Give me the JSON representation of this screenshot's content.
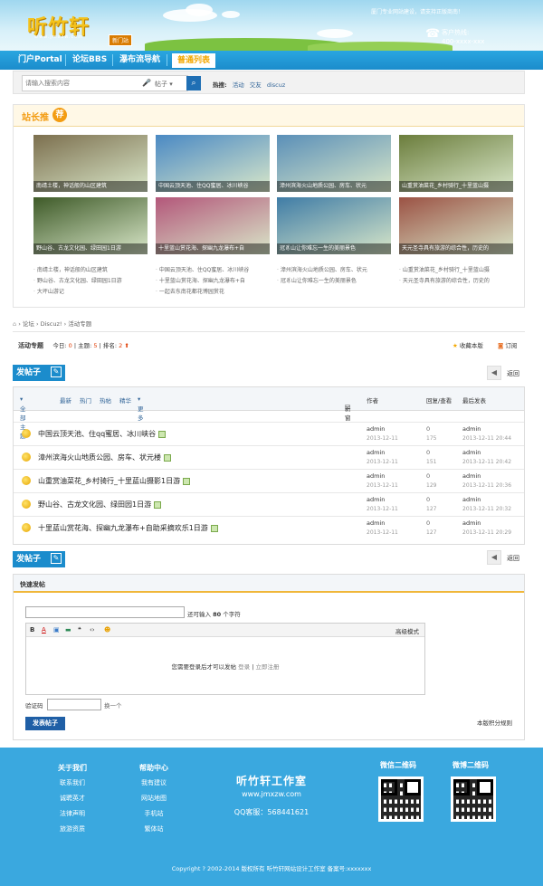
{
  "header": {
    "logo": "听竹轩",
    "logo_sub": "www.jmxzw.com",
    "logo_badge": "新门站",
    "slogan": "厦门专业网站建设，请支持正版商南！",
    "hotline_label": "客户热线:",
    "hotline_number": "400-xxxx-xxx"
  },
  "nav": {
    "items": [
      "门户Portal",
      "论坛BBS",
      "瀑布流导航",
      "普通列表"
    ]
  },
  "search": {
    "placeholder": "请输入搜索内容",
    "scope": "帖子",
    "hot_label": "热搜:",
    "hot_words": [
      "活动",
      "交友",
      "discuz"
    ]
  },
  "recommend": {
    "title": "站长推",
    "badge": "荐",
    "photos": [
      {
        "caption": "南靖土楼，神话般的山区建筑",
        "bg": "#7c6f4e"
      },
      {
        "caption": "中国云顶天池、住QQ蜜居、冰川峡谷",
        "bg": "#4a89c4"
      },
      {
        "caption": "漳州滨海火山地质公园、房车、状元",
        "bg": "#5a8fb8"
      },
      {
        "caption": "山重赏油菜花_乡村骑行_十里蓝山摄",
        "bg": "#6b7d3c"
      },
      {
        "caption": "野山谷、古龙文化园、绿田园1日游",
        "bg": "#3e5a28"
      },
      {
        "caption": "十里蓝山赏花海、探幽九龙瀑布+自",
        "bg": "#b3577a"
      },
      {
        "caption": "冠豸山让你难忘一生的美丽景色",
        "bg": "#3f7ca6"
      },
      {
        "caption": "天元圣寺具有旅游的综合性，历史的",
        "bg": "#9b5244"
      }
    ],
    "links": [
      [
        "南靖土楼，神话般的山区建筑",
        "野山谷、古龙文化园、绿田园1日游",
        "大坪山游记"
      ],
      [
        "中国云顶天池、住QQ蜜居、冰川峡谷",
        "十里蓝山赏花海、探幽九龙瀑布+自",
        "一起去东南花都花博园赏花"
      ],
      [
        "漳州滨海火山地质公园、房车、状元",
        "冠豸山让你难忘一生的美丽景色"
      ],
      [
        "山重赏油菜花_乡村骑行_十里蓝山摄",
        "天元圣寺具有旅游的综合性，历史的"
      ]
    ]
  },
  "breadcrumb": [
    "论坛",
    "Discuz!",
    "活动专题"
  ],
  "forum": {
    "name": "活动专题",
    "today_label": "今日:",
    "today": "0",
    "topics_label": "主题:",
    "topics": "5",
    "rank_label": "排名:",
    "rank": "2",
    "favorite": "收藏本版",
    "subscribe": "订阅"
  },
  "actions": {
    "post": "发帖子",
    "back": "返回"
  },
  "thread_head": {
    "filters": [
      "全部主题",
      "最新",
      "热门",
      "热帖",
      "精华",
      "更多"
    ],
    "new_window": "新窗",
    "author": "作者",
    "reply_view": "回复/查看",
    "last_post": "最后发表"
  },
  "threads": [
    {
      "title": "中国云顶天池、住qq蜜居、冰川峡谷",
      "author": "admin",
      "date": "2013-12-11",
      "replies": "0",
      "views": "175",
      "last_author": "admin",
      "last_date": "2013-12-11 20:44"
    },
    {
      "title": "漳州滨海火山地质公园、房车、状元楼",
      "author": "admin",
      "date": "2013-12-11",
      "replies": "0",
      "views": "151",
      "last_author": "admin",
      "last_date": "2013-12-11 20:42"
    },
    {
      "title": "山重赏油菜花_乡村骑行_十里蓝山摄影1日游",
      "author": "admin",
      "date": "2013-12-11",
      "replies": "0",
      "views": "129",
      "last_author": "admin",
      "last_date": "2013-12-11 20:36"
    },
    {
      "title": "野山谷、古龙文化园、绿田园1日游",
      "author": "admin",
      "date": "2013-12-11",
      "replies": "0",
      "views": "127",
      "last_author": "admin",
      "last_date": "2013-12-11 20:32"
    },
    {
      "title": "十里蓝山赏花海、探幽九龙瀑布+自助采摘欢乐1日游",
      "author": "admin",
      "date": "2013-12-11",
      "replies": "0",
      "views": "127",
      "last_author": "admin",
      "last_date": "2013-12-11 20:29"
    }
  ],
  "quick_post": {
    "title": "快速发帖",
    "tip_prefix": "还可输入",
    "tip_count": "80",
    "tip_suffix": "个字符",
    "toolbar": [
      "B",
      "A",
      "▣",
      "▬",
      "❝",
      "‹›",
      "☻"
    ],
    "advanced": "高级模式",
    "login_msg": "您需要登录后才可以发帖",
    "login": "登录",
    "register": "立即注册",
    "captcha_label": "验证码",
    "captcha_next": "换一个",
    "submit": "发表帖子",
    "rules": "本版积分规则"
  },
  "footer": {
    "about_title": "关于我们",
    "about_items": [
      "联系我们",
      "诚聘英才",
      "法律声明",
      "旅游资质"
    ],
    "help_title": "帮助中心",
    "help_items": [
      "我有建议",
      "网站地图",
      "手机站",
      "繁体站"
    ],
    "brand": "听竹轩工作室",
    "domain": "www.jmxzw.com",
    "qq": "QQ客服：568441621",
    "wechat_title": "微信二维码",
    "weibo_title": "微博二维码",
    "copyright": "Copyright ? 2002-2014    版权所有  听竹轩网站设计工作室    备案号:xxxxxxx"
  }
}
